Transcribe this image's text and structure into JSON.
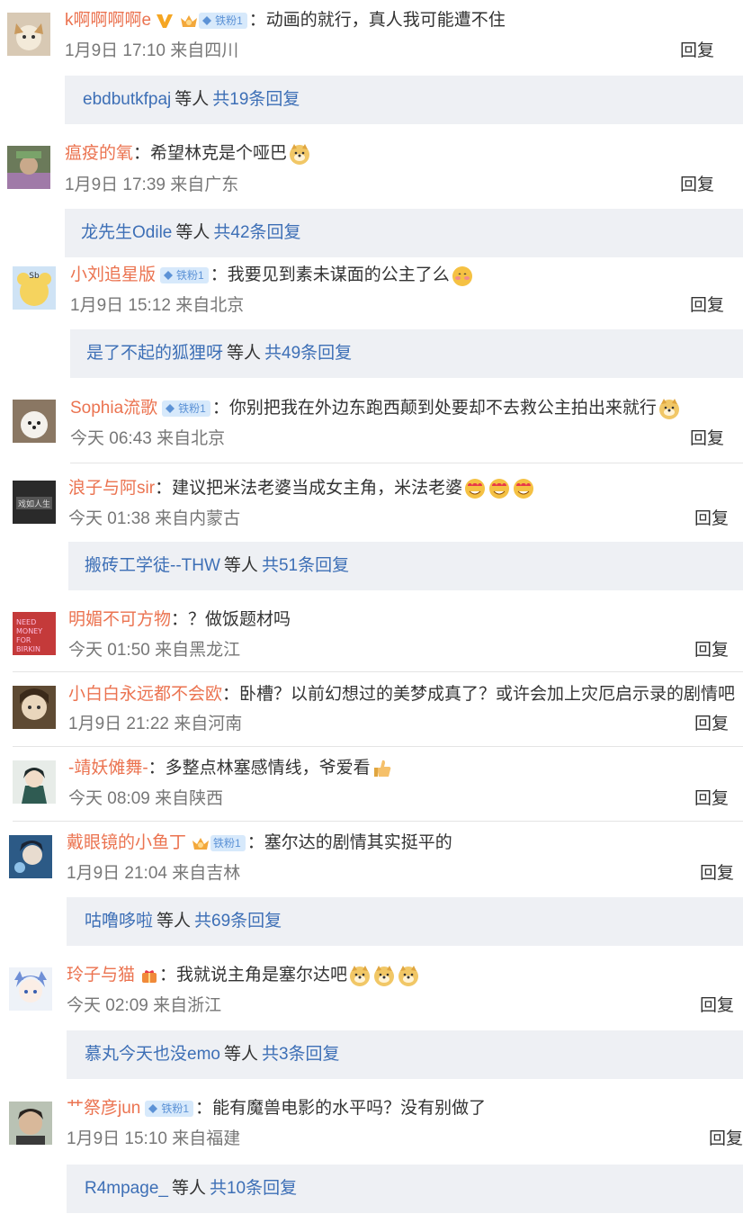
{
  "reply_label": "回复",
  "thread_middle": "等人",
  "comments": [
    {
      "user": "k啊啊啊啊e",
      "badge": "",
      "text": "动画的就行，真人我可能遭不住",
      "time": "1月9日 17:10",
      "location": "来自四川",
      "thread": {
        "user": "ebdbutkfpaj",
        "count": "共19条回复"
      }
    },
    {
      "user": "瘟疫的氧",
      "badge": "",
      "text": "希望林克是个哑巴",
      "time": "1月9日 17:39",
      "location": "来自广东",
      "thread": {
        "user": "龙先生Odile",
        "count": "共42条回复"
      }
    },
    {
      "user": "小刘追星版",
      "badge": "铁粉1",
      "text": "我要见到素未谋面的公主了么",
      "time": "1月9日 15:12",
      "location": "来自北京",
      "thread": {
        "user": "是了不起的狐狸呀",
        "count": "共49条回复"
      }
    },
    {
      "user": "Sophia流歌",
      "badge": "铁粉1",
      "text": "你别把我在外边东跑西颠到处要却不去救公主拍出来就行",
      "time": "今天 06:43",
      "location": "来自北京"
    },
    {
      "user": "浪子与阿sir",
      "badge": "",
      "text": "建议把米法老婆当成女主角，米法老婆",
      "time": "今天 01:38",
      "location": "来自内蒙古",
      "thread": {
        "user": "搬砖工学徒--THW",
        "count": "共51条回复"
      }
    },
    {
      "user": "明媚不可方物",
      "badge": "",
      "text": "？做饭题材吗",
      "time": "今天 01:50",
      "location": "来自黑龙江"
    },
    {
      "user": "小白白永远都不会欧",
      "badge": "",
      "text": "卧槽？以前幻想过的美梦成真了？或许会加上灾厄启示录的剧情吧",
      "time": "1月9日 21:22",
      "location": "来自河南"
    },
    {
      "user": "-靖妖傩舞-",
      "badge": "",
      "text": "多整点林塞感情线，爷爱看",
      "time": "今天 08:09",
      "location": "来自陕西"
    },
    {
      "user": "戴眼镜的小鱼丁",
      "badge": "铁粉1",
      "text": "塞尔达的剧情其实挺平的",
      "time": "1月9日 21:04",
      "location": "来自吉林",
      "thread": {
        "user": "咕噜哆啦",
        "count": "共69条回复"
      }
    },
    {
      "user": "玲子与猫",
      "badge": "",
      "text": "我就说主角是塞尔达吧",
      "time": "今天 02:09",
      "location": "来自浙江",
      "thread": {
        "user": "慕丸今天也没emo",
        "count": "共3条回复"
      }
    },
    {
      "user": "艹祭彦jun",
      "badge": "铁粉1",
      "text": "能有魔兽电影的水平吗？没有别做了",
      "time": "1月9日 15:10",
      "location": "来自福建",
      "thread": {
        "user": "R4mpage_",
        "count": "共10条回复"
      }
    }
  ]
}
